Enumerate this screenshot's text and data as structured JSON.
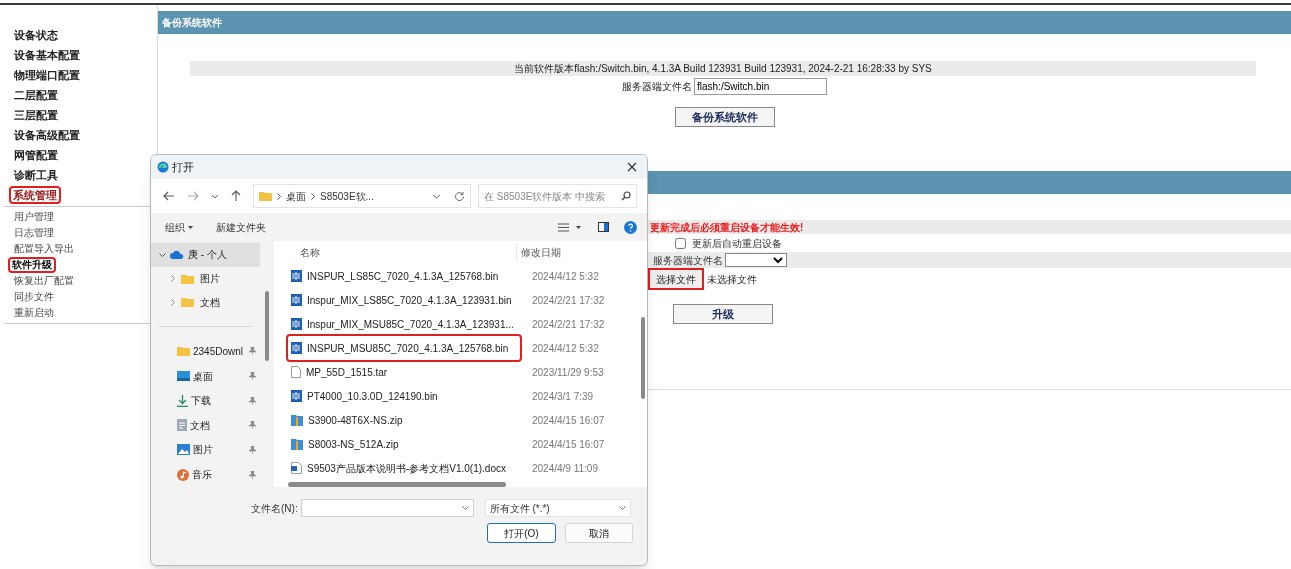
{
  "sidebar": {
    "items": [
      {
        "label": "设备状态",
        "selected": false,
        "highlighted": false
      },
      {
        "label": "设备基本配置",
        "selected": false,
        "highlighted": false
      },
      {
        "label": "物理端口配置",
        "selected": false,
        "highlighted": false
      },
      {
        "label": "二层配置",
        "selected": false,
        "highlighted": false
      },
      {
        "label": "三层配置",
        "selected": false,
        "highlighted": false
      },
      {
        "label": "设备高级配置",
        "selected": false,
        "highlighted": false
      },
      {
        "label": "网管配置",
        "selected": false,
        "highlighted": false
      },
      {
        "label": "诊断工具",
        "selected": false,
        "highlighted": false
      },
      {
        "label": "系统管理",
        "selected": true,
        "highlighted": true
      }
    ],
    "subitems": [
      {
        "label": "用户管理",
        "selected": false,
        "highlighted": false
      },
      {
        "label": "日志管理",
        "selected": false,
        "highlighted": false
      },
      {
        "label": "配置导入导出",
        "selected": false,
        "highlighted": false
      },
      {
        "label": "软件升级",
        "selected": true,
        "highlighted": true
      },
      {
        "label": "恢复出厂配置",
        "selected": false,
        "highlighted": false
      },
      {
        "label": "同步文件",
        "selected": false,
        "highlighted": false
      },
      {
        "label": "重新启动",
        "selected": false,
        "highlighted": false
      }
    ]
  },
  "backup_section": {
    "title": "备份系统软件",
    "current_version": "当前软件版本flash:/Switch.bin, 4.1.3A Build 123931 Build 123931, 2024-2-21 16:28:33 by SYS",
    "server_filename_label": "服务器端文件名",
    "server_filename_value": "flash:/Switch.bin",
    "button": "备份系统软件"
  },
  "upgrade_section": {
    "warning": "更新完成后必须重启设备才能生效!",
    "auto_reboot": {
      "label": "更新后自动重启设备",
      "checked": false
    },
    "server_filename_label": "服务器端文件名",
    "file_button": {
      "label": "选择文件",
      "highlighted": true
    },
    "file_status": "未选择文件",
    "button": "升级"
  },
  "dialog": {
    "title": "打开",
    "address": [
      "桌面",
      "S8503E软..."
    ],
    "search_placeholder": "在 S8503E软件版本 中搜索",
    "organize": "组织",
    "new_folder": "新建文件夹",
    "nav": [
      {
        "label": "庚 - 个人",
        "kind": "cloud",
        "selected": true,
        "expanded": true,
        "children": [
          {
            "label": "图片",
            "kind": "folder",
            "selected": false,
            "expanded": false
          },
          {
            "label": "文档",
            "kind": "folder",
            "selected": false,
            "expanded": false
          }
        ]
      }
    ],
    "quick_access": [
      {
        "label": "2345Downl",
        "kind": "folder",
        "pinned": true
      },
      {
        "label": "桌面",
        "kind": "desktop",
        "pinned": true
      },
      {
        "label": "下载",
        "kind": "download",
        "pinned": true
      },
      {
        "label": "文档",
        "kind": "documents",
        "pinned": true
      },
      {
        "label": "图片",
        "kind": "pictures",
        "pinned": true
      },
      {
        "label": "音乐",
        "kind": "music",
        "pinned": true
      }
    ],
    "columns": [
      "名称",
      "修改日期"
    ],
    "files": [
      {
        "kind": "bin",
        "name": "INSPUR_LS85C_7020_4.1.3A_125768.bin",
        "date": "2024/4/12 5:32",
        "highlighted": false
      },
      {
        "kind": "bin",
        "name": "Inspur_MIX_LS85C_7020_4.1.3A_123931.bin",
        "date": "2024/2/21 17:32",
        "highlighted": false
      },
      {
        "kind": "bin",
        "name": "Inspur_MIX_MSU85C_7020_4.1.3A_123931...",
        "date": "2024/2/21 17:32",
        "highlighted": false
      },
      {
        "kind": "bin",
        "name": "INSPUR_MSU85C_7020_4.1.3A_125768.bin",
        "date": "2024/4/12 5:32",
        "highlighted": true
      },
      {
        "kind": "file",
        "name": "MP_55D_1515.tar",
        "date": "2023/11/29 9:53",
        "highlighted": false
      },
      {
        "kind": "bin",
        "name": "PT4000_10.3.0D_124190.bin",
        "date": "2024/3/1 7:39",
        "highlighted": false
      },
      {
        "kind": "zip",
        "name": "S3900-48T6X-NS.zip",
        "date": "2024/4/15 16:07",
        "highlighted": false
      },
      {
        "kind": "zip",
        "name": "S8003-NS_512A.zip",
        "date": "2024/4/15 16:07",
        "highlighted": false
      },
      {
        "kind": "docx",
        "name": "S9503产品版本说明书-参考文档V1.0(1).docx",
        "date": "2024/4/9 11:09",
        "highlighted": false
      }
    ],
    "filename_label": "文件名(N):",
    "filter": "所有文件 (*.*)",
    "open_button": "打开(O)",
    "cancel_button": "取消"
  }
}
